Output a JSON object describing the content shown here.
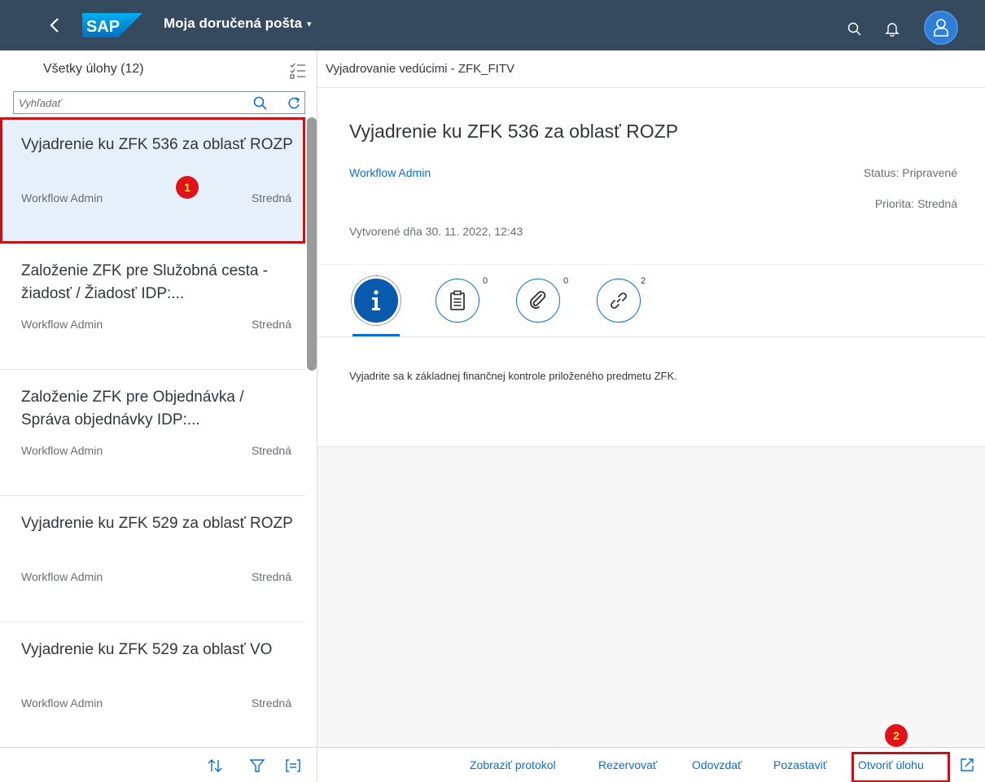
{
  "shell": {
    "title": "Moja doručená pošta",
    "caret": "▾",
    "logo_text": "SAP"
  },
  "master": {
    "title": "Všetky úlohy (12)",
    "search_placeholder": "Vyhľadať",
    "items": [
      {
        "title": "Vyjadrenie ku ZFK 536 za oblasť ROZP",
        "owner": "Workflow Admin",
        "priority": "Stredná"
      },
      {
        "title": "Založenie ZFK pre Služobná cesta - žiadosť / Žiadosť IDP:...",
        "owner": "Workflow Admin",
        "priority": "Stredná"
      },
      {
        "title": "Založenie ZFK pre Objednávka / Správa objednávky IDP:...",
        "owner": "Workflow Admin",
        "priority": "Stredná"
      },
      {
        "title": "Vyjadrenie ku ZFK 529 za oblasť ROZP",
        "owner": "Workflow Admin",
        "priority": "Stredná"
      },
      {
        "title": "Vyjadrenie ku ZFK 529 za oblasť VO",
        "owner": "Workflow Admin",
        "priority": "Stredná"
      }
    ]
  },
  "badges": {
    "one": "1",
    "two": "2"
  },
  "detail": {
    "bar_title": "Vyjadrovanie vedúcimi - ZFK_FITV",
    "title": "Vyjadrenie ku ZFK 536 za oblasť ROZP",
    "created_by": "Workflow Admin",
    "status": "Status: Pripravené",
    "priority": "Priorita: Stredná",
    "created": "Vytvorené dňa 30. 11. 2022, 12:43",
    "tabs": [
      {
        "icon": "info-icon",
        "count": ""
      },
      {
        "icon": "notes-icon",
        "count": "0"
      },
      {
        "icon": "attachment-icon",
        "count": "0"
      },
      {
        "icon": "link-icon",
        "count": "2"
      }
    ],
    "description": "Vyjadrite sa k základnej finančnej kontrole priloženého predmetu ZFK."
  },
  "footer": {
    "show_log": "Zobraziť protokol",
    "reserve": "Rezervovať",
    "forward": "Odovzdať",
    "suspend": "Pozastaviť",
    "open_task": "Otvoriť úlohu"
  },
  "colors": {
    "shell": "#354a5f",
    "accent": "#0a6ed1",
    "highlight_border": "#c0141b",
    "badge": "#e0131b"
  }
}
